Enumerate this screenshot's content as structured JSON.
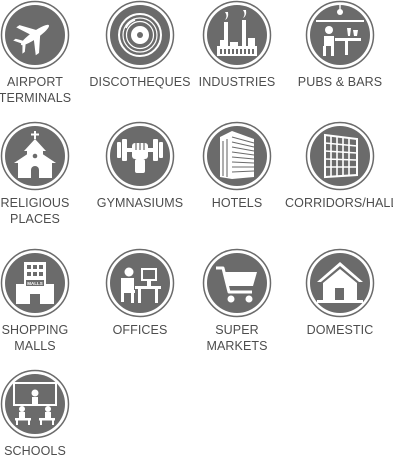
{
  "colors": {
    "badge_fill": "#6b6b6b",
    "badge_ring": "#6b6b6b",
    "icon_fill": "#ffffff",
    "label_text": "#4d4d4d"
  },
  "venues": [
    {
      "id": "airport",
      "icon": "airplane-icon",
      "label_lines": [
        "AIRPORT",
        "TERMINALS"
      ]
    },
    {
      "id": "discotheques",
      "icon": "vinyl-record-icon",
      "label_lines": [
        "DISCOTHEQUES"
      ]
    },
    {
      "id": "industries",
      "icon": "factory-icon",
      "label_lines": [
        "INDUSTRIES"
      ]
    },
    {
      "id": "pubs",
      "icon": "bar-counter-icon",
      "label_lines": [
        "PUBS & BARS"
      ]
    },
    {
      "id": "religious",
      "icon": "chapel-icon",
      "label_lines": [
        "RELIGIOUS",
        "PLACES"
      ]
    },
    {
      "id": "gym",
      "icon": "dumbbell-fist-icon",
      "label_lines": [
        "GYMNASIUMS"
      ]
    },
    {
      "id": "hotels",
      "icon": "hotel-building-icon",
      "label_lines": [
        "HOTELS"
      ]
    },
    {
      "id": "corridors",
      "icon": "grid-hall-icon",
      "label_lines": [
        "CORRIDORS/HALLS"
      ]
    },
    {
      "id": "malls",
      "icon": "mall-building-icon",
      "label_lines": [
        "SHOPPING",
        "MALLS"
      ]
    },
    {
      "id": "offices",
      "icon": "office-desk-icon",
      "label_lines": [
        "OFFICES"
      ]
    },
    {
      "id": "supermarkets",
      "icon": "shopping-cart-icon",
      "label_lines": [
        "SUPER",
        "MARKETS"
      ]
    },
    {
      "id": "domestic",
      "icon": "house-icon",
      "label_lines": [
        "DOMESTIC"
      ]
    },
    {
      "id": "schools",
      "icon": "classroom-icon",
      "label_lines": [
        "SCHOOLS"
      ]
    }
  ],
  "mall_sign": "MALLS"
}
